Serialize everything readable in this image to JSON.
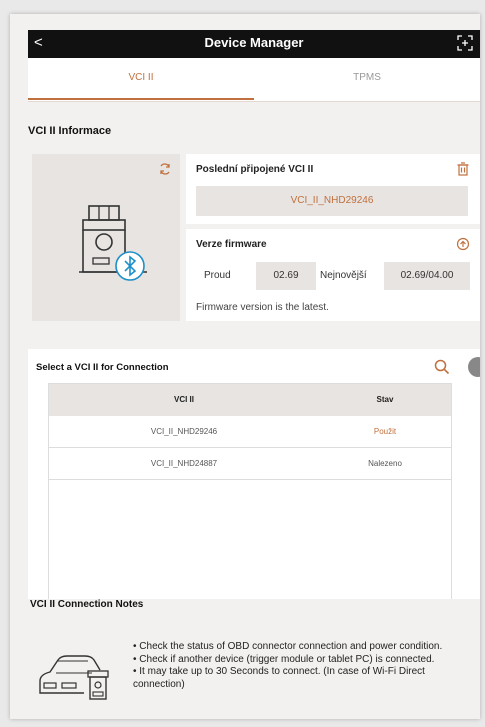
{
  "header": {
    "back_glyph": "<",
    "title": "Device Manager"
  },
  "tabs": [
    {
      "label": "VCI II",
      "active": true
    },
    {
      "label": "TPMS",
      "active": false
    }
  ],
  "info": {
    "section_title": "VCI II Informace",
    "last_connected": {
      "title": "Poslední připojené VCI II",
      "value": "VCI_II_NHD29246"
    },
    "firmware": {
      "title": "Verze firmware",
      "current_label": "Proud",
      "current_value": "02.69",
      "latest_label": "Nejnovější",
      "latest_value": "02.69/04.00",
      "note": "Firmware version is the latest."
    }
  },
  "select": {
    "title": "Select a VCI II for Connection",
    "columns": [
      "VCI II",
      "Stav"
    ],
    "rows": [
      {
        "name": "VCI_II_NHD29246",
        "status": "Použit"
      },
      {
        "name": "VCI_II_NHD24887",
        "status": "Nalezeno"
      }
    ]
  },
  "notes": {
    "title": "VCI II Connection Notes",
    "items": [
      "• Check the status of OBD connector connection and power condition.",
      "• Check if another device (trigger module or tablet PC) is connected.",
      "• It may take up to 30 Seconds to connect. (In case of Wi-Fi Direct connection)"
    ]
  },
  "colors": {
    "accent": "#c0703e",
    "header_bg": "#111111",
    "panel_gray": "#e8e4e1"
  },
  "icons": [
    "back-icon",
    "expand-icon",
    "refresh-icon",
    "delete-icon",
    "firmware-update-icon",
    "search-icon",
    "vci-device-icon",
    "bluetooth-icon",
    "car-icon"
  ]
}
